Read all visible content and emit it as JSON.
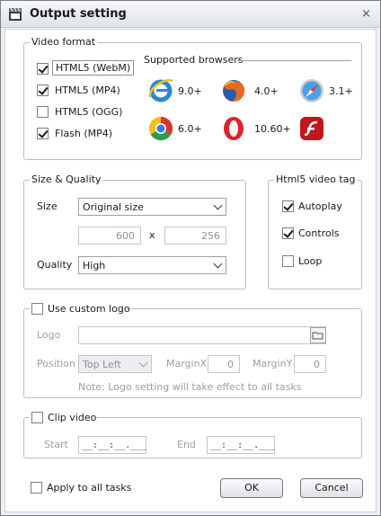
{
  "window": {
    "title": "Output setting",
    "close_glyph": "×"
  },
  "video_format": {
    "legend": "Video format",
    "formats": [
      {
        "label": "HTML5 (WebM)",
        "checked": true
      },
      {
        "label": "HTML5 (MP4)",
        "checked": true
      },
      {
        "label": "HTML5 (OGG)",
        "checked": false
      },
      {
        "label": "Flash (MP4)",
        "checked": true
      }
    ],
    "supported_browsers_label": "Supported browsers",
    "browsers": [
      {
        "icon": "internet-explorer-icon",
        "version": "9.0+"
      },
      {
        "icon": "firefox-icon",
        "version": "4.0+"
      },
      {
        "icon": "safari-icon",
        "version": "3.1+"
      },
      {
        "icon": "chrome-icon",
        "version": "6.0+"
      },
      {
        "icon": "opera-icon",
        "version": "10.60+"
      },
      {
        "icon": "flash-player-icon",
        "version": ""
      }
    ]
  },
  "size_quality": {
    "legend": "Size & Quality",
    "size_label": "Size",
    "size_value": "Original size",
    "width": "600",
    "x_label": "x",
    "height": "256",
    "quality_label": "Quality",
    "quality_value": "High"
  },
  "html5_tag": {
    "legend": "Html5 video tag",
    "options": [
      {
        "label": "Autoplay",
        "checked": true
      },
      {
        "label": "Controls",
        "checked": true
      },
      {
        "label": "Loop",
        "checked": false
      }
    ]
  },
  "custom_logo": {
    "label": "Use custom logo",
    "checked": false,
    "logo_label": "Logo",
    "logo_path": "",
    "position_label": "Position",
    "position_value": "Top Left",
    "marginx_label": "MarginX",
    "marginx_value": "0",
    "marginy_label": "MarginY",
    "marginy_value": "0",
    "note": "Note: Logo setting will take effect to all tasks"
  },
  "clip_video": {
    "label": "Clip video",
    "checked": false,
    "start_label": "Start",
    "start_value": "__:__:__.___",
    "end_label": "End",
    "end_value": "__:__:__.___"
  },
  "footer": {
    "apply_all_label": "Apply to all tasks",
    "apply_all_checked": false,
    "ok_label": "OK",
    "cancel_label": "Cancel"
  }
}
